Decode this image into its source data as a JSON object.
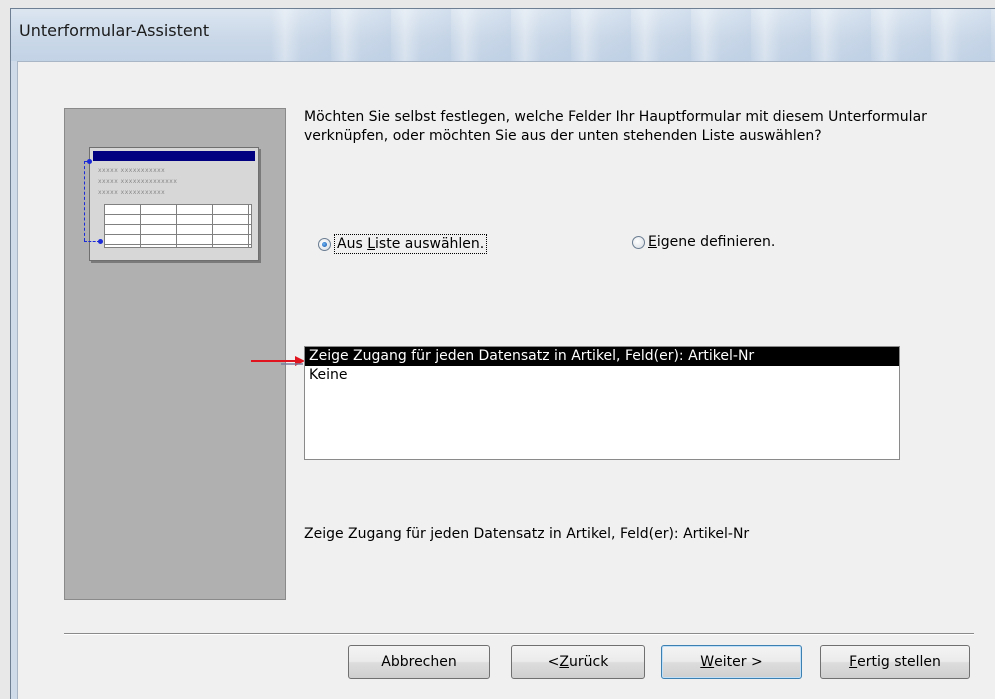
{
  "window": {
    "title": "Unterformular-Assistent"
  },
  "preview": {
    "line1": "xxxxx xxxxxxxxxxx",
    "line2": "xxxxx xxxxxxxxxxxxxx",
    "line3": "xxxxx xxxxxxxxxxx"
  },
  "question": "Möchten Sie selbst festlegen, welche Felder Ihr Hauptformular mit diesem Unterformular verknüpfen, oder möchten Sie aus der unten stehenden Liste auswählen?",
  "options": {
    "list": {
      "pre": "Aus ",
      "key": "L",
      "post": "iste auswählen.",
      "checked": true
    },
    "custom": {
      "pre": "",
      "key": "E",
      "post": "igene definieren.",
      "checked": false
    }
  },
  "link_list": {
    "items": [
      "Zeige Zugang für jeden Datensatz in Artikel, Feld(er): Artikel-Nr",
      "Keine"
    ],
    "selected_index": 0
  },
  "description": "Zeige Zugang für jeden Datensatz in Artikel, Feld(er): Artikel-Nr",
  "buttons": {
    "cancel": "Abbrechen",
    "back": {
      "pre": "< ",
      "key": "Z",
      "post": "urück"
    },
    "next": {
      "pre": "",
      "key": "W",
      "post": "eiter >"
    },
    "finish": {
      "pre": "",
      "key": "F",
      "post": "ertig stellen"
    }
  },
  "colors": {
    "selection": "#000000",
    "preview_header": "#000080",
    "link_line": "#1b2ad8",
    "annotation_arrow": "#e0141e"
  },
  "icons": {
    "annotation": "red-arrow-icon"
  }
}
